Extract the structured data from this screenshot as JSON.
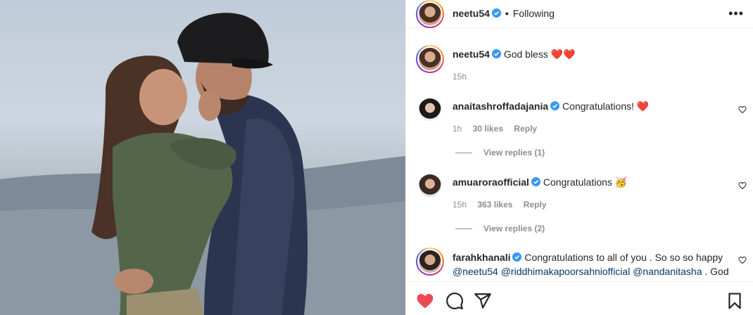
{
  "colors": {
    "verified": "#3897f0",
    "like": "#ed4956",
    "meta": "#8e8e8e",
    "link": "#00376b"
  },
  "photo": {
    "alt_icon": "couple-photo"
  },
  "header": {
    "username": "neetu54",
    "separator": "•",
    "follow_status": "Following",
    "more_icon": "more-horizontal-icon"
  },
  "caption": {
    "username": "neetu54",
    "text": "God bless",
    "emoji": "❤️❤️",
    "time": "15h"
  },
  "comments": [
    {
      "username": "anaitashroffadajania",
      "text": "Congratulations!",
      "emoji": "❤️",
      "time": "1h",
      "likes": "30 likes",
      "reply_label": "Reply",
      "view_replies": "View replies (1)"
    },
    {
      "username": "amuaroraofficial",
      "text": "Congratulations",
      "emoji": "🥳",
      "time": "15h",
      "likes": "363 likes",
      "reply_label": "Reply",
      "view_replies": "View replies (2)"
    },
    {
      "username": "farahkhanali",
      "text": "Congratulations to all of you . So so so happy",
      "line2_mentions": "@neetu54 @riddhimakapoorsahniofficial @nandanitasha",
      "line2_tail": " . God"
    }
  ],
  "actions": {
    "like_icon": "heart-filled-icon",
    "comment_icon": "comment-icon",
    "share_icon": "share-icon",
    "save_icon": "bookmark-icon"
  }
}
